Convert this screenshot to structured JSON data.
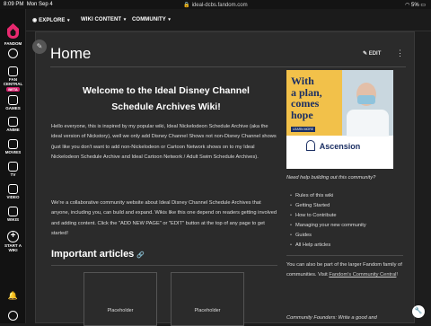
{
  "status": {
    "time": "8:09 PM",
    "date": "Mon Sep 4",
    "url": "ideal-dcbs.fandom.com",
    "battery": "5%"
  },
  "rail": {
    "brand": "FANDOM",
    "items": [
      {
        "label": "FAN CENTRAL",
        "badge": "BETA"
      },
      {
        "label": "GAMES"
      },
      {
        "label": "ANIME"
      },
      {
        "label": "MOVIES"
      },
      {
        "label": "TV"
      },
      {
        "label": "VIDEO"
      },
      {
        "label": "WIKIS"
      },
      {
        "label": "START A WIKI"
      }
    ]
  },
  "topnav": [
    {
      "label": "EXPLORE",
      "icon": "compass-icon"
    },
    {
      "label": "WIKI CONTENT"
    },
    {
      "label": "COMMUNITY"
    }
  ],
  "page": {
    "title": "Home",
    "edit_label": "EDIT",
    "welcome": "Welcome to the Ideal Disney Channel Schedule Archives Wiki!",
    "intro": "Hello everyone, this is inspired by my popular wiki, Ideal Nickelodeon Schedule Archive (aka the ideal version of Nickstory), well we only add Disney Channel Shows not non-Disney Channel shows (just like you don't want to add non-Nickelodeon or Cartoon Network shows on to my Ideal Nickelodeon Schedule Archive and Ideal Cartoon Network / Adult Swim Schedule Archives).",
    "collab": "We're a collaborative community website about Ideal Disney Channel Schedule Archives that anyone, including you, can build and expand. Wikis like this one depend on readers getting involved and adding content. Click the \"ADD NEW PAGE\" or \"EDIT\" button at the top of any page to get started!",
    "section_heading": "Important articles",
    "placeholders": [
      "Placeholder",
      "Placeholder"
    ]
  },
  "ad": {
    "headline": [
      "With",
      "a plan,",
      "comes",
      "hope"
    ],
    "cta": "LEARN MORE",
    "brand": "Ascension",
    "colors": {
      "brand": "#1b2f63",
      "accent": "#f2c14a"
    }
  },
  "sidebar": {
    "help_question": "Need help building out this community?",
    "links": [
      "Rules of this wiki",
      "Getting Started",
      "How to Contribute",
      "Managing your new community",
      "Guides",
      "All Help articles"
    ],
    "family_text": "You can also be part of the larger Fandom family of communities. Visit",
    "family_link": "Fandom's Community Central",
    "family_end": "!",
    "founders": "Community Founders: Write a good and"
  },
  "colors": {
    "fandom_accent": "#d4206c",
    "background": "#1d1d1d",
    "page": "#2b2b2b"
  }
}
